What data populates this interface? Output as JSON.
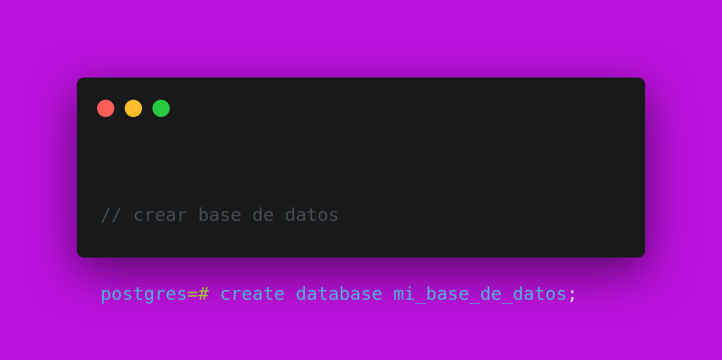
{
  "window": {
    "controls": {
      "close": "close",
      "minimize": "minimize",
      "maximize": "maximize"
    },
    "code": {
      "comment": "// crear base de datos",
      "prompt_name": "postgres",
      "prompt_op": "=#",
      "command": " create database mi_base_de_datos",
      "terminator": ";"
    }
  },
  "colors": {
    "background": "#bb12dc",
    "window": "#18191a",
    "close": "#ff5f56",
    "minimize": "#ffbd2e",
    "maximize": "#27c93f",
    "comment": "#454d51",
    "identifier": "#4fb4d8",
    "operator": "#a0c83c"
  }
}
